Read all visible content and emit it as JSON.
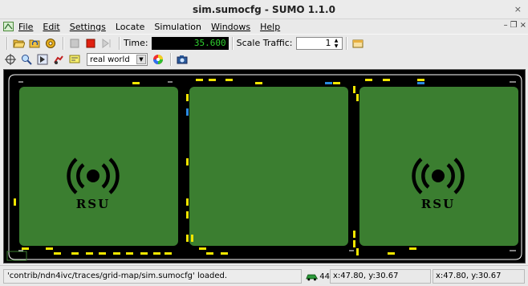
{
  "window": {
    "title": "sim.sumocfg - SUMO 1.1.0",
    "close_glyph": "×"
  },
  "menubar": {
    "items": [
      {
        "label": "File",
        "mnemonic": "F"
      },
      {
        "label": "Edit",
        "mnemonic": "E"
      },
      {
        "label": "Settings",
        "mnemonic": "S"
      },
      {
        "label": "Locate",
        "mnemonic": "L"
      },
      {
        "label": "Simulation",
        "mnemonic": ""
      },
      {
        "label": "Windows",
        "mnemonic": "W"
      },
      {
        "label": "Help",
        "mnemonic": "H"
      }
    ],
    "mdi_controls": [
      "–",
      "❐",
      "×"
    ]
  },
  "toolbar": {
    "time_label": "Time:",
    "time_value": "35.600",
    "scale_label": "Scale Traffic:",
    "scale_value": "1"
  },
  "viewbar": {
    "scheme_value": "real world"
  },
  "canvas": {
    "rsu_label": "RSU",
    "background_color": "#000000",
    "block_color": "#3b7e30",
    "vehicle_color": "#f2e600",
    "vehicle_alt_color": "#2a8ae0"
  },
  "status": {
    "message": "'contrib/ndn4ivc/traces/grid-map/sim.sumocfg' loaded.",
    "vehicle_count": "44",
    "coord_left": "x:47.80, y:30.67",
    "coord_right": "x:47.80, y:30.67"
  },
  "icons": {
    "app": "sumo-app-icon",
    "open": "open-folder-icon",
    "reload": "reload-icon",
    "settings": "settings-icon",
    "start": "run-icon",
    "stop": "stop-icon",
    "step": "step-icon",
    "locate": "locate-icon",
    "zoom": "zoom-icon",
    "edit_vehicle": "vehicle-icon",
    "edit_chooser": "tag-icon",
    "color_wheel": "color-wheel-icon",
    "snapshot": "camera-icon",
    "delay": "delay-icon"
  }
}
